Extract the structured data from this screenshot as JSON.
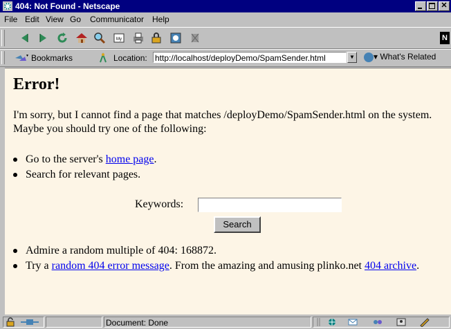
{
  "window": {
    "title": "404: Not Found - Netscape",
    "controls": {
      "minimize": "",
      "maximize": "",
      "close": "✕"
    }
  },
  "menu": [
    "File",
    "Edit",
    "View",
    "Go",
    "Communicator",
    "Help"
  ],
  "toolbar": {
    "buttons": [
      "back-icon",
      "forward-icon",
      "reload-icon",
      "home-icon",
      "search-icon",
      "my-netscape-icon",
      "print-icon",
      "security-icon",
      "shop-icon",
      "stop-icon"
    ]
  },
  "location_bar": {
    "bookmarks_label": "Bookmarks",
    "location_label": "Location:",
    "url": "http://localhost/deployDemo/SpamSender.html",
    "related_label": "What's Related"
  },
  "page": {
    "heading": "Error!",
    "intro": "I'm sorry, but I cannot find a page that matches /deployDemo/SpamSender.html on the system. Maybe you should try one of the following:",
    "item1_prefix": "Go to the server's ",
    "item1_link": "home page",
    "item1_suffix": ".",
    "item2": "Search for relevant pages.",
    "keywords_label": "Keywords:",
    "keywords_value": "",
    "search_button": "Search",
    "item3": "Admire a random multiple of 404: 168872.",
    "item4_prefix": "Try a ",
    "item4_link": "random 404 error message",
    "item4_middle": ". From the amazing and amusing plinko.net ",
    "item4_link2": "404 archive",
    "item4_suffix": "."
  },
  "status": {
    "text": "Document: Done"
  },
  "colors": {
    "titlebar": "#000080",
    "chrome": "#c0c0c0",
    "page_background": "#fdf5e6",
    "link": "#0000ee"
  }
}
